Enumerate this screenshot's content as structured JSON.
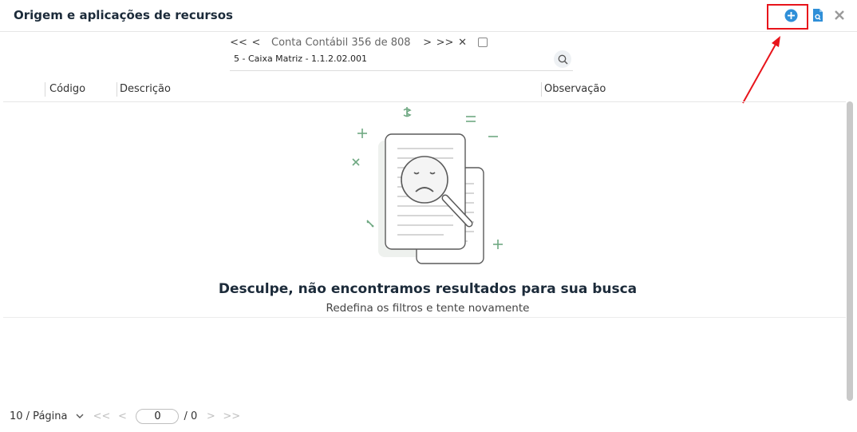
{
  "header": {
    "title": "Origem e aplicações de recursos",
    "icons": [
      "plus-circle-icon",
      "report-icon",
      "close-icon"
    ]
  },
  "navigator": {
    "first": "<<",
    "prev": "<",
    "label": "Conta Contábil 356 de 808",
    "next": ">",
    "last": ">>",
    "clear": "✕"
  },
  "search": {
    "value": "5 - Caixa Matriz  - 1.1.2.02.001"
  },
  "table": {
    "columns": [
      "Código",
      "Descrição",
      "Observação"
    ]
  },
  "empty_state": {
    "title": "Desculpe, não encontramos resultados para sua busca",
    "subtitle": "Redefina os filtros e tente novamente"
  },
  "pagination": {
    "page_size": "10 / Página",
    "first": "<<",
    "prev": "<",
    "current": "0",
    "total": "/ 0",
    "next": ">",
    "last": ">>"
  },
  "colors": {
    "accent": "#2f8fd8",
    "highlight": "#e8141b",
    "illustration_green": "#6fa882"
  }
}
